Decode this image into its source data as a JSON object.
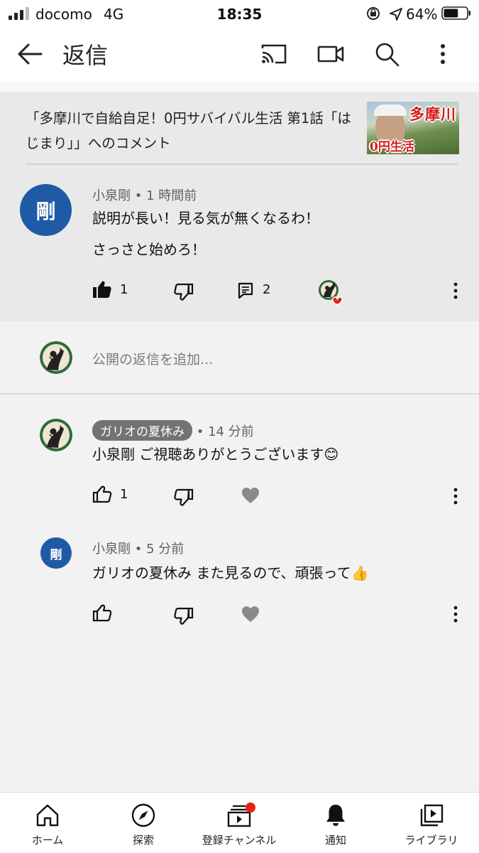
{
  "status_bar": {
    "carrier": "docomo",
    "network": "4G",
    "time": "18:35",
    "battery": "64%",
    "battery_level": 0.64
  },
  "app_bar": {
    "title": "返信",
    "icons": [
      "back-arrow-icon",
      "cast-icon",
      "video-camera-icon",
      "search-icon",
      "more-vertical-icon"
    ]
  },
  "header": {
    "video_title": "「多摩川で自給自足！0円サバイバル生活 第1話「はじまり」」へのコメント",
    "thumbnail_text_top": "多摩川",
    "thumbnail_text_bottom": "0円生活"
  },
  "main_comment": {
    "avatar_char": "剛",
    "author": "小泉剛",
    "time": "1 時間前",
    "lines": [
      "説明が長い！見る気が無くなるわ！",
      "さっさと始めろ！"
    ],
    "likes": "1",
    "replies": "2",
    "icons": [
      "thumbs-up-filled-icon",
      "thumbs-down-icon",
      "reply-icon",
      "creator-heart-icon",
      "more-vertical-icon"
    ]
  },
  "reply_box": {
    "placeholder": "公開の返信を追加..."
  },
  "replies": [
    {
      "author": "ガリオの夏休み",
      "author_is_creator": true,
      "time": "14 分前",
      "text": "小泉剛 ご視聴ありがとうございます😊",
      "likes": "1"
    },
    {
      "avatar_char": "剛",
      "author": "小泉剛",
      "time": "5 分前",
      "text": "ガリオの夏休み また見るので、頑張って👍",
      "likes": ""
    }
  ],
  "bottom_nav": {
    "items": [
      {
        "label": "ホーム",
        "icon": "home-icon"
      },
      {
        "label": "探索",
        "icon": "explore-compass-icon"
      },
      {
        "label": "登録チャンネル",
        "icon": "subscriptions-icon"
      },
      {
        "label": "通知",
        "icon": "bell-icon"
      },
      {
        "label": "ライブラリ",
        "icon": "library-icon"
      }
    ]
  },
  "colors": {
    "avatar_blue": "#1f5aa6",
    "heart_red": "#e62117",
    "chip_gray": "#737373"
  }
}
